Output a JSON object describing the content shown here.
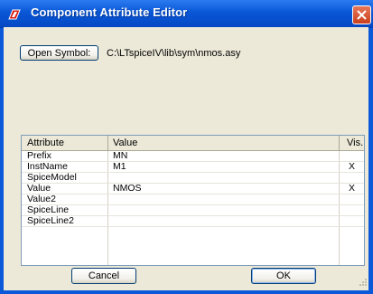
{
  "window": {
    "title": "Component Attribute Editor"
  },
  "toolbar": {
    "open_symbol_label": "Open Symbol:",
    "symbol_path": "C:\\LTspiceIV\\lib\\sym\\nmos.asy"
  },
  "table": {
    "columns": [
      "Attribute",
      "Value",
      "Vis."
    ],
    "rows": [
      {
        "attribute": "Prefix",
        "value": "MN",
        "vis": ""
      },
      {
        "attribute": "InstName",
        "value": "M1",
        "vis": "X"
      },
      {
        "attribute": "SpiceModel",
        "value": "",
        "vis": ""
      },
      {
        "attribute": "Value",
        "value": "NMOS",
        "vis": "X"
      },
      {
        "attribute": "Value2",
        "value": "",
        "vis": ""
      },
      {
        "attribute": "SpiceLine",
        "value": "",
        "vis": ""
      },
      {
        "attribute": "SpiceLine2",
        "value": "",
        "vis": ""
      }
    ]
  },
  "footer": {
    "cancel_label": "Cancel",
    "ok_label": "OK"
  },
  "colors": {
    "titlebar": "#0a57d6",
    "dialog": "#ece9d8",
    "close": "#c9401c"
  }
}
